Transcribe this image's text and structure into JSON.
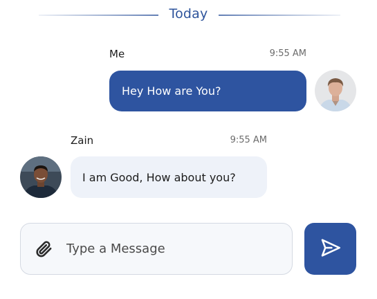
{
  "date_divider": {
    "label": "Today"
  },
  "messages": [
    {
      "sender": "Me",
      "time": "9:55 AM",
      "text": "Hey How are You?",
      "direction": "outgoing",
      "avatar": "user-photo-me"
    },
    {
      "sender": "Zain",
      "time": "9:55 AM",
      "text": "I am Good, How about you?",
      "direction": "incoming",
      "avatar": "user-photo-zain"
    }
  ],
  "composer": {
    "placeholder": "Type a Message",
    "value": "",
    "attach_icon": "paperclip-icon",
    "send_icon": "send-icon"
  },
  "colors": {
    "accent": "#2e54a0",
    "incoming_bubble": "#eef2f9",
    "input_background": "#f6f8fb",
    "input_border": "#d4d9e2",
    "time_text": "#6b6b6b"
  }
}
